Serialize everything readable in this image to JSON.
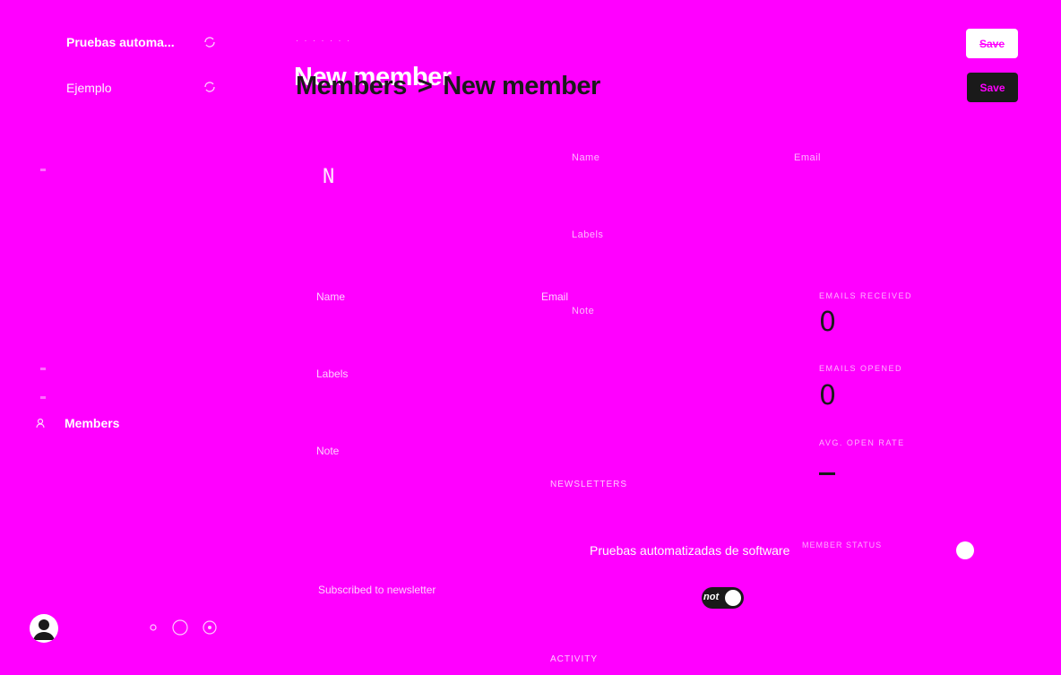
{
  "sidebar": {
    "sites": [
      {
        "label": "Pruebas automa..."
      },
      {
        "label": "Ejemplo"
      }
    ],
    "nav": {
      "members_label": "Members"
    }
  },
  "header": {
    "breadcrumb_small": "· · · · · · ·",
    "ghost_title": "New member",
    "breadcrumb_parent": "Members",
    "breadcrumb_separator": ">",
    "title": "New member",
    "save_ghost_label": "Save",
    "save_label": "Save"
  },
  "form": {
    "avatar_placeholder": "N",
    "name_label_ghost": "Name",
    "email_label_ghost": "Email",
    "labels_label_ghost": "Labels",
    "note_label_ghost": "Note",
    "name_label": "Name",
    "email_label": "Email",
    "labels_label": "Labels",
    "note_label": "Note",
    "name_value": "",
    "email_value": "",
    "labels_value": "",
    "note_value": ""
  },
  "stats": {
    "emails_received_label": "EMAILS RECEIVED",
    "emails_received_value": "0",
    "emails_opened_label": "EMAILS OPENED",
    "emails_opened_value": "0",
    "avg_open_rate_label": "AVG. OPEN RATE"
  },
  "newsletters": {
    "section_title": "NEWSLETTERS",
    "items": [
      {
        "name": "Pruebas automatizadas de software",
        "status": "MEMBER STATUS"
      }
    ],
    "subscribe_label": "Subscribed to newsletter",
    "toggle_text": "not"
  },
  "activity": {
    "section_title": "ACTIVITY"
  },
  "colors": {
    "background": "#ff00ff",
    "dark": "#1a1a1a",
    "white": "#ffffff"
  }
}
